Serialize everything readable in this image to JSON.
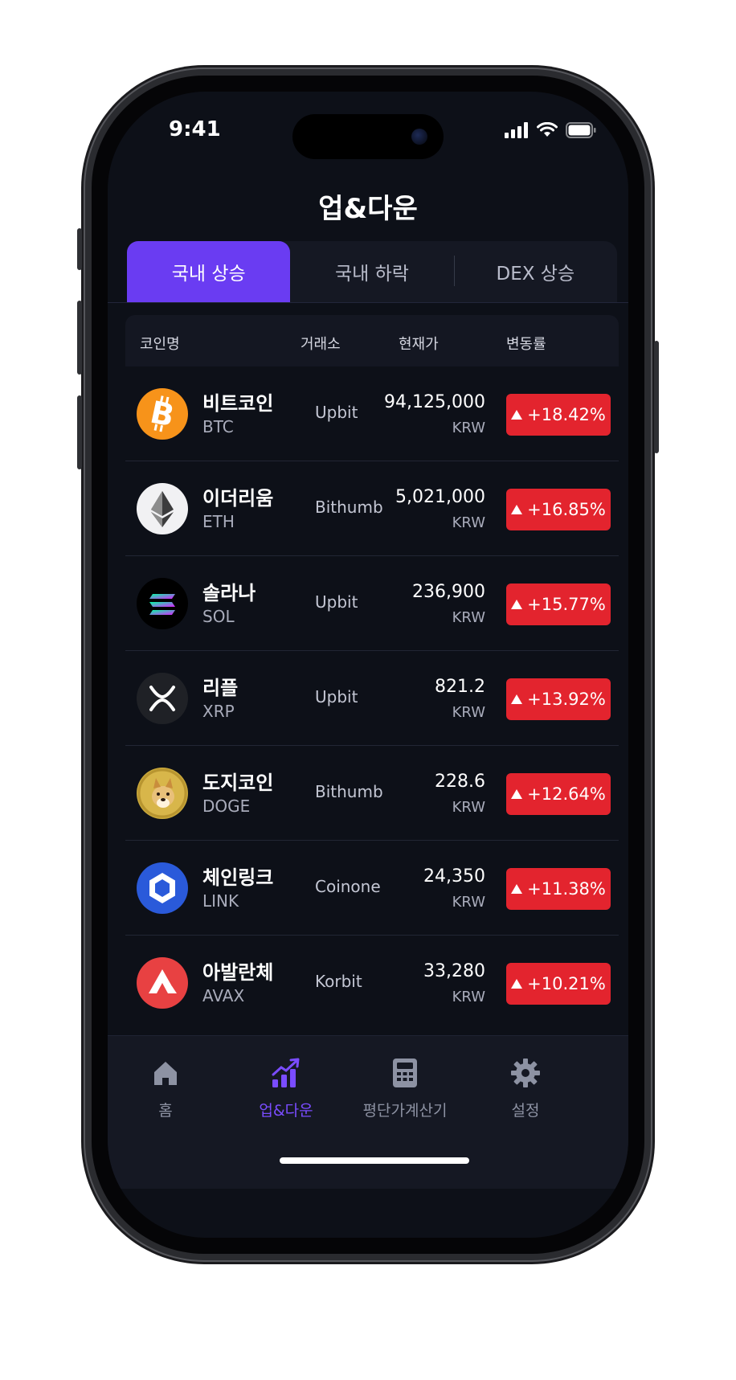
{
  "status": {
    "time": "9:41"
  },
  "header": {
    "title": "업&다운"
  },
  "tabs": [
    {
      "label": "국내 상승",
      "active": true
    },
    {
      "label": "국내 하락",
      "active": false
    },
    {
      "label": "DEX 상승",
      "active": false
    }
  ],
  "table": {
    "columns": {
      "coin": "코인명",
      "exchange": "거래소",
      "price": "현재가",
      "change": "변동률"
    },
    "rows": [
      {
        "name": "비트코인",
        "symbol": "BTC",
        "exchange": "Upbit",
        "price": "94,125,000",
        "currency": "KRW",
        "change": "+18.42%",
        "icon": "bitcoin-icon"
      },
      {
        "name": "이더리움",
        "symbol": "ETH",
        "exchange": "Bithumb",
        "price": "5,021,000",
        "currency": "KRW",
        "change": "+16.85%",
        "icon": "ethereum-icon"
      },
      {
        "name": "솔라나",
        "symbol": "SOL",
        "exchange": "Upbit",
        "price": "236,900",
        "currency": "KRW",
        "change": "+15.77%",
        "icon": "solana-icon"
      },
      {
        "name": "리플",
        "symbol": "XRP",
        "exchange": "Upbit",
        "price": "821.2",
        "currency": "KRW",
        "change": "+13.92%",
        "icon": "xrp-icon"
      },
      {
        "name": "도지코인",
        "symbol": "DOGE",
        "exchange": "Bithumb",
        "price": "228.6",
        "currency": "KRW",
        "change": "+12.64%",
        "icon": "dogecoin-icon"
      },
      {
        "name": "체인링크",
        "symbol": "LINK",
        "exchange": "Coinone",
        "price": "24,350",
        "currency": "KRW",
        "change": "+11.38%",
        "icon": "chainlink-icon"
      },
      {
        "name": "아발란체",
        "symbol": "AVAX",
        "exchange": "Korbit",
        "price": "33,280",
        "currency": "KRW",
        "change": "+10.21%",
        "icon": "avalanche-icon"
      }
    ]
  },
  "bottom_nav": [
    {
      "label": "홈",
      "icon": "home-icon",
      "active": false
    },
    {
      "label": "업&다운",
      "icon": "chart-up-icon",
      "active": true
    },
    {
      "label": "평단가계산기",
      "icon": "calculator-icon",
      "active": false
    },
    {
      "label": "설정",
      "icon": "gear-icon",
      "active": false
    }
  ],
  "colors": {
    "accent": "#6a3cf2",
    "up_badge": "#e3242e",
    "background": "#0d1018"
  }
}
